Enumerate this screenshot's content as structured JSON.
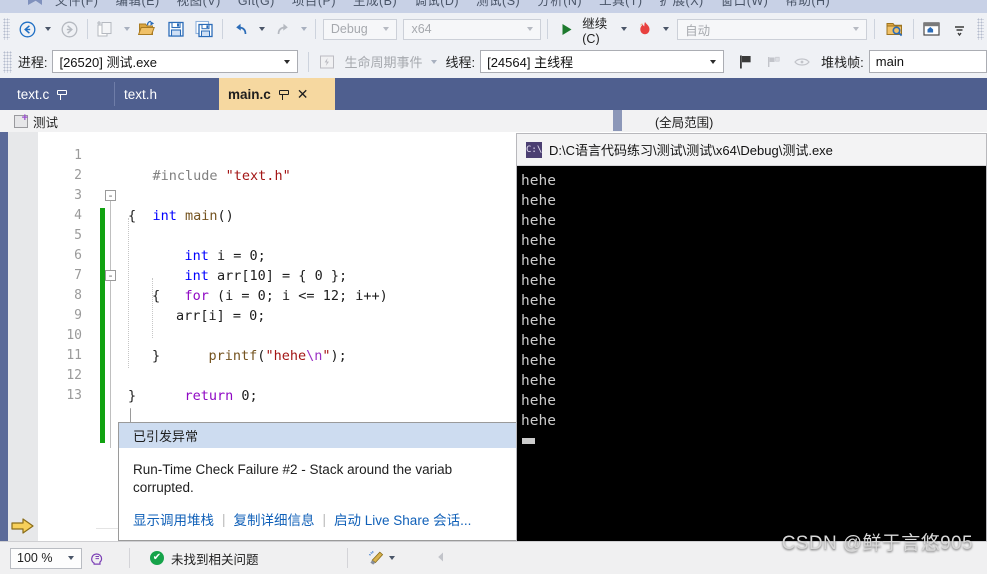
{
  "menu": {
    "items": [
      "文件(F)",
      "编辑(E)",
      "视图(V)",
      "Git(G)",
      "项目(P)",
      "生成(B)",
      "调试(D)",
      "测试(S)",
      "分析(N)",
      "工具(T)",
      "扩展(X)",
      "窗口(W)",
      "帮助(H)"
    ],
    "logo": "visual-studio-logo"
  },
  "toolbar": {
    "nav_back_icon": "navigate-back-icon",
    "nav_forward_icon": "navigate-forward-icon",
    "new_item_icon": "new-item-icon",
    "open_file_icon": "open-file-icon",
    "save_icon": "save-icon",
    "save_all_icon": "save-all-icon",
    "undo_icon": "undo-icon",
    "redo_icon": "redo-icon",
    "config_value": "Debug",
    "platform_value": "x64",
    "continue_label": "继续(C)",
    "continue_icon": "play-icon",
    "hot_reload_icon": "hot-reload-flame-icon",
    "auto_value": "自动",
    "search_folder_icon": "search-folder-icon",
    "home_window_icon": "home-window-icon",
    "overflow_icon": "toolbar-overflow-icon"
  },
  "debugbar": {
    "process_label": "进程:",
    "process_value": "[26520] 测试.exe",
    "lifecycle_icon": "lifecycle-events-icon",
    "lifecycle_label": "生命周期事件",
    "thread_label": "线程:",
    "thread_value": "[24564] 主线程",
    "flag_icon": "flag-icon",
    "flag_group_icon": "flag-group-icon",
    "fish_icon": "parallel-stacks-icon",
    "stackframe_label": "堆栈帧:",
    "stackframe_value": "main"
  },
  "tabs": [
    {
      "label": "text.c",
      "active": false,
      "pinned": true
    },
    {
      "label": "text.h",
      "active": false,
      "pinned": false
    },
    {
      "label": "main.c",
      "active": true,
      "pinned": true,
      "close": "✕"
    }
  ],
  "scope": {
    "project_icon": "cpp-project-icon",
    "project_name": "测试",
    "global_scope": "(全局范围)"
  },
  "editor": {
    "line_numbers": [
      "1",
      "2",
      "3",
      "4",
      "5",
      "6",
      "7",
      "8",
      "9",
      "10",
      "11",
      "12",
      "13"
    ],
    "code_lines": [
      "#include \"text.h\"",
      "",
      "int main()",
      "{",
      "    int i = 0;",
      "    int arr[10] = { 0 };",
      "    for (i = 0; i <= 12; i++)",
      "    {",
      "        arr[i] = 0;",
      "        printf(\"hehe\\n\");",
      "    }",
      "    return 0;",
      "}"
    ],
    "execution_marker": "current-statement-arrow",
    "error_marker": "error-circle-icon",
    "collapse_glyph": "-"
  },
  "exception_popup": {
    "title": "已引发异常",
    "message_line1": "Run-Time Check Failure #2 - Stack around the variab",
    "message_line2": "corrupted.",
    "links": [
      "显示调用堆栈",
      "复制详细信息",
      "启动 Live Share 会话..."
    ],
    "separator": "|"
  },
  "console": {
    "icon": "console-app-icon",
    "title": "D:\\C语言代码练习\\测试\\测试\\x64\\Debug\\测试.exe",
    "lines": [
      "hehe",
      "hehe",
      "hehe",
      "hehe",
      "hehe",
      "hehe",
      "hehe",
      "hehe",
      "hehe",
      "hehe",
      "hehe",
      "hehe",
      "hehe"
    ],
    "cursor": "block-cursor"
  },
  "status_bar": {
    "zoom_value": "100 %",
    "intellisense_icon": "intellisense-head-icon",
    "problems_icon": "ok-check-icon",
    "problems_text": "未找到相关问题",
    "brush_icon": "code-cleanup-brush-icon",
    "scroll_left_icon": "scroll-left-arrow-icon"
  },
  "watermark": "CSDN @鲜于言悠905",
  "colors": {
    "tab_band": "#4f5f8f",
    "active_tab": "#f6d8a0",
    "toolbar_bg": "#eff1f5",
    "console_bg": "#000000",
    "change_bar": "#11a211",
    "error_red": "#d93025",
    "link_blue": "#1060b8"
  }
}
